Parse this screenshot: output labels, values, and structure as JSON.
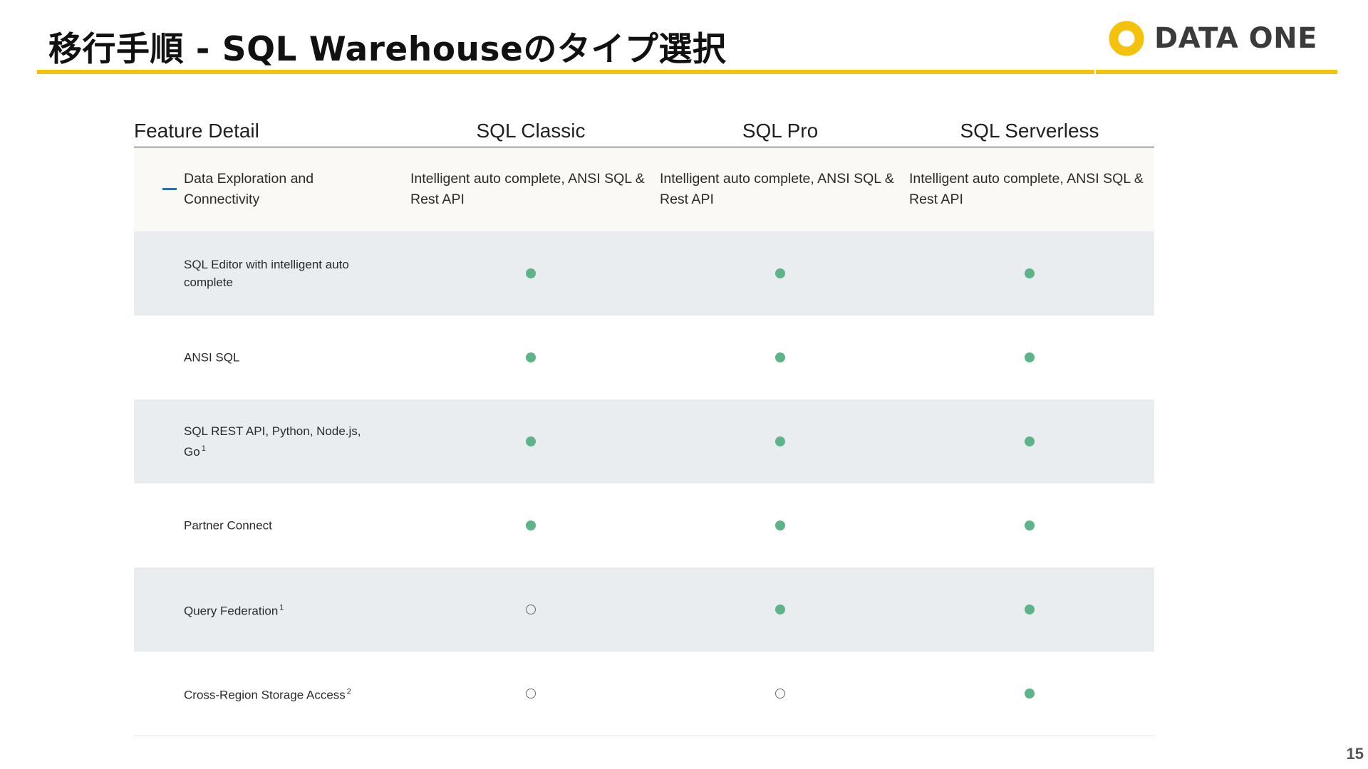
{
  "slide": {
    "title": "移行手順 - SQL Warehouseのタイプ選択",
    "logo_text": "DATA ONE",
    "page_number": "15",
    "accent_color": "#f4c20d"
  },
  "table": {
    "headers": [
      "Feature Detail",
      "SQL Classic",
      "SQL Pro",
      "SQL Serverless"
    ],
    "group": {
      "label": "Data Exploration and Connectivity",
      "classic": "Intelligent auto complete, ANSI SQL & Rest API",
      "pro": "Intelligent auto complete, ANSI SQL & Rest API",
      "serverless": "Intelligent auto complete, ANSI SQL & Rest API"
    },
    "rows": [
      {
        "label": "SQL Editor with intelligent auto complete",
        "note": "",
        "classic": "full",
        "pro": "full",
        "serverless": "full"
      },
      {
        "label": "ANSI SQL",
        "note": "",
        "classic": "full",
        "pro": "full",
        "serverless": "full"
      },
      {
        "label": "SQL REST API, Python, Node.js, Go",
        "note": "1",
        "classic": "full",
        "pro": "full",
        "serverless": "full"
      },
      {
        "label": "Partner Connect",
        "note": "",
        "classic": "full",
        "pro": "full",
        "serverless": "full"
      },
      {
        "label": "Query Federation",
        "note": "1",
        "classic": "empty",
        "pro": "full",
        "serverless": "full"
      },
      {
        "label": "Cross-Region Storage Access",
        "note": "2",
        "classic": "empty",
        "pro": "empty",
        "serverless": "full"
      }
    ],
    "mark_colors": {
      "full": "#5db488",
      "empty": "#6a6a6a"
    }
  }
}
